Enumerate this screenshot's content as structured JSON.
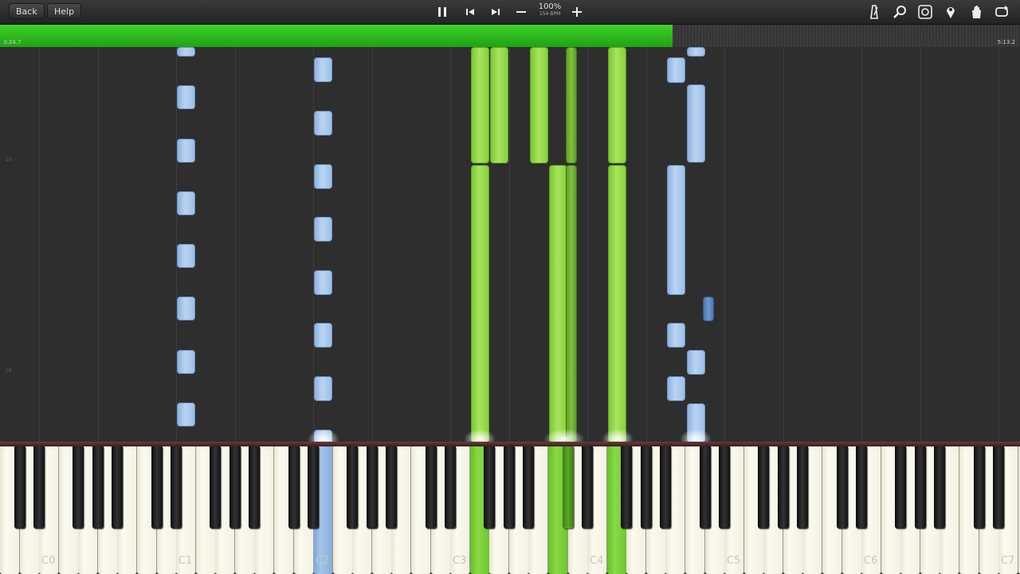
{
  "toolbar": {
    "back_label": "Back",
    "help_label": "Help",
    "speed_percent": "100%",
    "speed_bpm": "154 BPM",
    "icons": [
      "pause-icon",
      "previous-icon",
      "next-icon",
      "minus-icon",
      "plus-icon",
      "metronome-icon",
      "search-icon",
      "loop-icon",
      "marker-icon",
      "hand-icon",
      "repeat-icon"
    ]
  },
  "timeline": {
    "current_time": "3:24.7",
    "total_time": "5:13.2",
    "progress": 0.659
  },
  "roll": {
    "measure_labels": [
      "19",
      "18"
    ]
  },
  "keyboard": {
    "octave_labels": [
      "C0",
      "C1",
      "C2",
      "C3",
      "C4",
      "C5",
      "C6",
      "C7"
    ]
  },
  "colors": {
    "left_hand": "#b9d4f2",
    "right_hand": "#a9e35f",
    "progress": "#2fbf1f"
  }
}
